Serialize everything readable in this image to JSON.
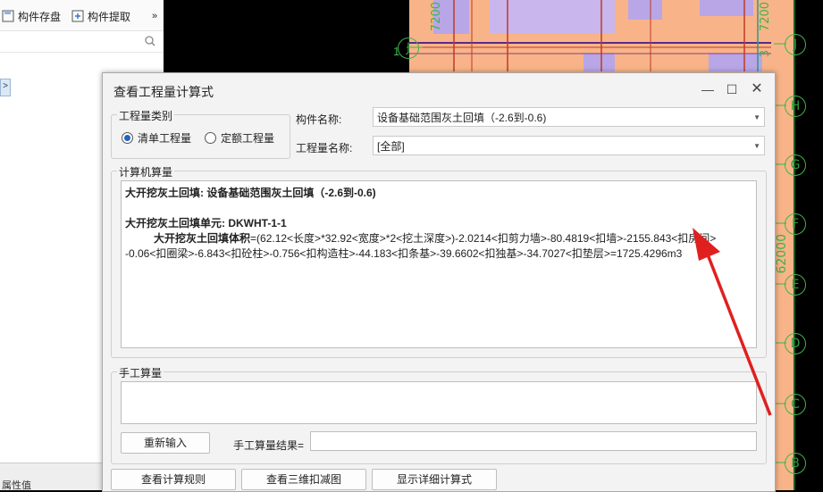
{
  "left_panel": {
    "store_label": "构件存盘",
    "extract_label": "构件提取",
    "more_glyph": "»",
    "bottom_label": "属性值"
  },
  "cad": {
    "axes": [
      "J",
      "H",
      "G",
      "F",
      "E",
      "D",
      "C",
      "B"
    ],
    "left_axis_label": "J",
    "left_axis_num": "1",
    "dimension_top": "7200",
    "dimension_top_left": "7200",
    "dimension_right": "62000",
    "dimension_mid": "3"
  },
  "dialog": {
    "title": "查看工程量计算式",
    "quantity_type_group": "工程量类别",
    "radio_list": "清单工程量",
    "radio_quota": "定额工程量",
    "component_name_label": "构件名称:",
    "component_name_value": "设备基础范围灰土回填（-2.6到-0.6)",
    "quantity_name_label": "工程量名称:",
    "quantity_name_value": "[全部]",
    "computer_calc_label": "计算机算量",
    "calc_line1": "大开挖灰土回填: 设备基础范围灰土回填（-2.6到-0.6)",
    "calc_line2": "大开挖灰土回填单元: DKWHT-1-1",
    "calc_line3_bold": "大开挖灰土回填体积",
    "calc_line3_rest": "=(62.12<长度>*32.92<宽度>*2<挖土深度>)-2.0214<扣剪力墙>-80.4819<扣墙>-2155.843<扣房间>",
    "calc_line4": "-0.06<扣圈梁>-6.843<扣砼柱>-0.756<扣构造柱>-44.183<扣条基>-39.6602<扣独基>-34.7027<扣垫层>=1725.4296m3",
    "manual_label": "手工算量",
    "reinput_button": "重新输入",
    "manual_result_label": "手工算量结果=",
    "manual_result_value": "",
    "btn_rules": "查看计算规则",
    "btn_3d": "查看三维扣减图",
    "btn_detail": "显示详细计算式"
  },
  "colors": {
    "cad_fill": "#f8b488",
    "cad_bg": "#000000",
    "axis_green": "#3fb44a",
    "annotation_red": "#e0201f",
    "radio_blue": "#1f63c8"
  }
}
